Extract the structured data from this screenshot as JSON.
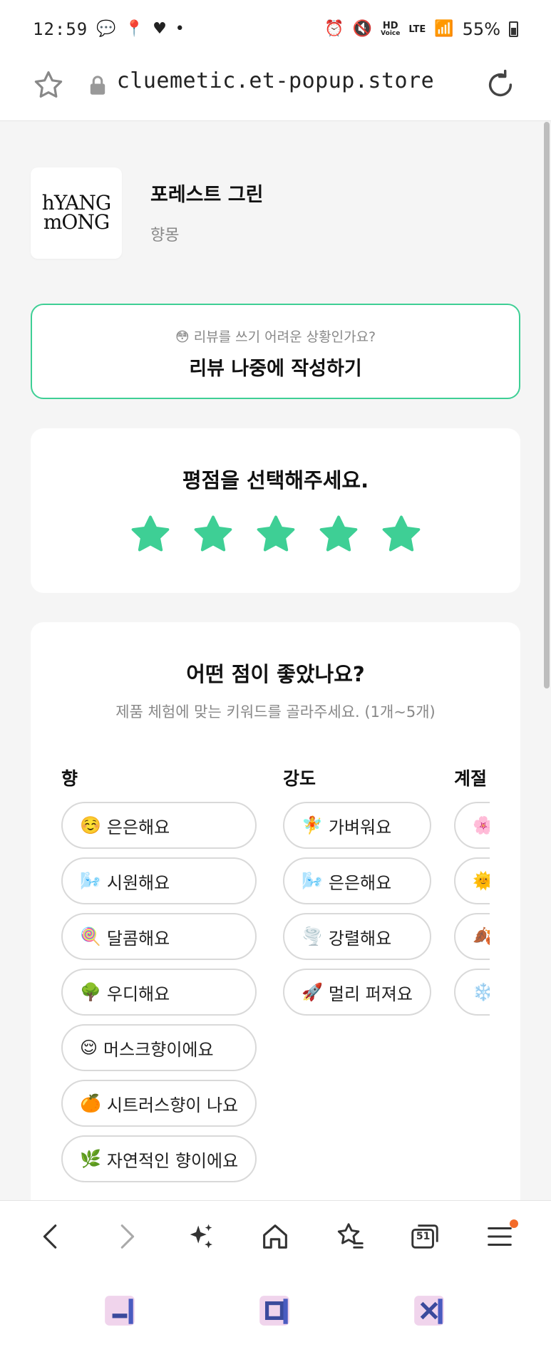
{
  "status_bar": {
    "time": "12:59",
    "battery": "55%",
    "hd_label": "HD",
    "hd_sub": "Voice",
    "lte_label": "LTE"
  },
  "browser": {
    "url": "cluemetic.et-popup.store",
    "tab_count": "51"
  },
  "product": {
    "logo_line1": "hYANG",
    "logo_line2": "mONG",
    "name": "포레스트 그린",
    "brand": "향몽"
  },
  "review_later": {
    "subtitle": "😳 리뷰를 쓰기 어려운 상황인가요?",
    "button_label": "리뷰 나중에 작성하기"
  },
  "rating": {
    "title": "평점을 선택해주세요.",
    "value": 5,
    "max": 5,
    "star_color": "#3ecf95"
  },
  "keywords": {
    "title": "어떤 점이 좋았나요?",
    "subtitle": "제품 체험에 맞는 키워드를 골라주세요. (1개~5개)",
    "columns": [
      {
        "header": "향",
        "chips": [
          {
            "emoji": "☺️",
            "label": "은은해요"
          },
          {
            "emoji": "🌬️",
            "label": "시원해요"
          },
          {
            "emoji": "🍭",
            "label": "달콤해요"
          },
          {
            "emoji": "🌳",
            "label": "우디해요"
          },
          {
            "emoji": "😌",
            "label": "머스크향이에요"
          },
          {
            "emoji": "🍊",
            "label": "시트러스향이 나요"
          },
          {
            "emoji": "🌿",
            "label": "자연적인 향이에요"
          }
        ]
      },
      {
        "header": "강도",
        "chips": [
          {
            "emoji": "🧚",
            "label": "가벼워요"
          },
          {
            "emoji": "🌬️",
            "label": "은은해요"
          },
          {
            "emoji": "🌪️",
            "label": "강렬해요"
          },
          {
            "emoji": "🚀",
            "label": "멀리 퍼져요"
          }
        ]
      },
      {
        "header": "계절",
        "chips": [
          {
            "emoji": "🌸",
            "label": ""
          },
          {
            "emoji": "🌞",
            "label": ""
          },
          {
            "emoji": "🍂",
            "label": ""
          },
          {
            "emoji": "❄️",
            "label": ""
          }
        ]
      }
    ]
  },
  "colors": {
    "accent": "#3ecf95",
    "menu_badge": "#f36b2a"
  }
}
